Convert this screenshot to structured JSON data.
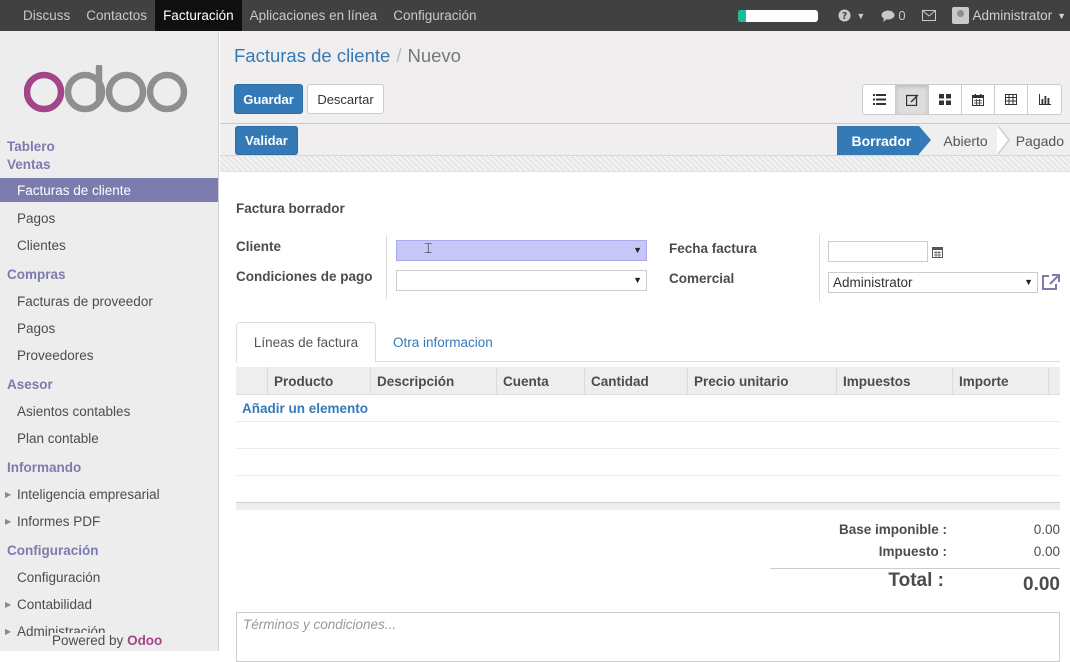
{
  "topbar": {
    "menu": [
      "Discuss",
      "Contactos",
      "Facturación",
      "Aplicaciones en línea",
      "Configuración"
    ],
    "active_menu": "Facturación",
    "loading_progress": 0.1,
    "messages_count": "0",
    "user": "Administrator"
  },
  "sidebar": {
    "sections": [
      {
        "title": "Tablero"
      },
      {
        "title": "Ventas",
        "items": [
          "Facturas de cliente",
          "Pagos",
          "Clientes"
        ]
      },
      {
        "title": "Compras",
        "items": [
          "Facturas de proveedor",
          "Pagos",
          "Proveedores"
        ]
      },
      {
        "title": "Asesor",
        "items": [
          "Asientos contables",
          "Plan contable"
        ]
      },
      {
        "title": "Informando",
        "items": [
          "Inteligencia empresarial",
          "Informes PDF"
        ]
      },
      {
        "title": "Configuración",
        "items": [
          "Configuración",
          "Contabilidad",
          "Administración"
        ]
      }
    ],
    "active_item": "Facturas de cliente",
    "powered_by": "Powered by",
    "powered_brand": "Odoo"
  },
  "breadcrumb": {
    "parent": "Facturas de cliente",
    "current": "Nuevo"
  },
  "buttons": {
    "save": "Guardar",
    "discard": "Descartar",
    "validate": "Validar"
  },
  "views": [
    "list-icon",
    "form-icon",
    "kanban-icon",
    "calendar-icon",
    "pivot-icon",
    "graph-icon"
  ],
  "active_view": "form-icon",
  "statusbar": {
    "stages": [
      "Borrador",
      "Abierto",
      "Pagado"
    ],
    "current": "Borrador"
  },
  "form": {
    "title": "Factura borrador",
    "customer_label": "Cliente",
    "customer_value": "",
    "payment_terms_label": "Condiciones de pago",
    "payment_terms_value": "",
    "invoice_date_label": "Fecha factura",
    "invoice_date_value": "",
    "salesperson_label": "Comercial",
    "salesperson_value": "Administrator"
  },
  "tabs": {
    "lines": "Líneas de factura",
    "other": "Otra informacion"
  },
  "table": {
    "columns": [
      "Producto",
      "Descripción",
      "Cuenta",
      "Cantidad",
      "Precio unitario",
      "Impuestos",
      "Importe"
    ],
    "add_item": "Añadir un elemento"
  },
  "totals": {
    "base_label": "Base imponible :",
    "base_value": "0.00",
    "tax_label": "Impuesto :",
    "tax_value": "0.00",
    "total_label": "Total :",
    "total_value": "0.00"
  },
  "terms_placeholder": "Términos y condiciones...",
  "colors": {
    "primary": "#337ab7",
    "sidebar_accent": "#7c7bad",
    "brand": "#a24689",
    "topbar": "#414141"
  }
}
